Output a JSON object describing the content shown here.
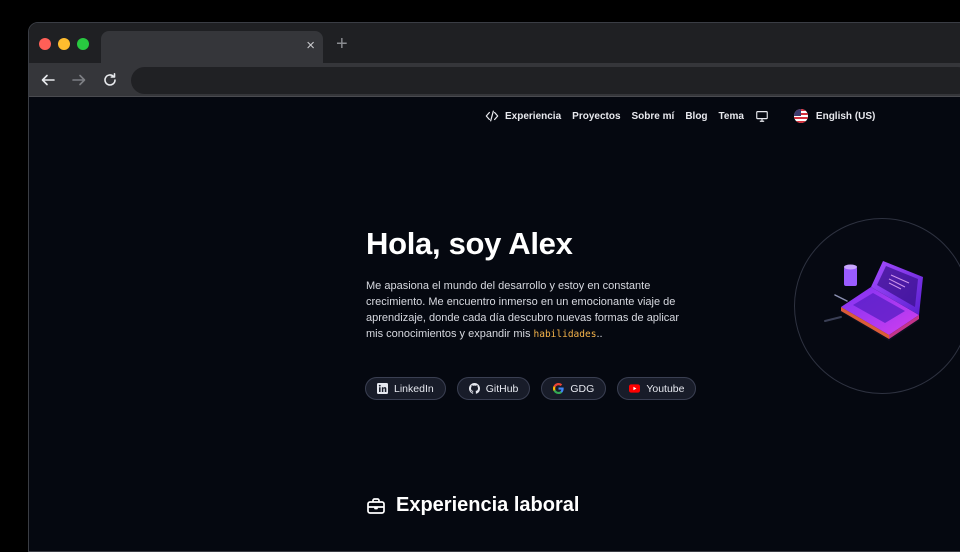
{
  "browser": {
    "tab_close": "×",
    "new_tab": "+"
  },
  "nav": {
    "experiencia": "Experiencia",
    "proyectos": "Proyectos",
    "sobre_mi": "Sobre mí",
    "blog": "Blog",
    "tema": "Tema",
    "language": "English (US)"
  },
  "hero": {
    "title": "Hola, soy Alex",
    "text": "Me apasiona el mundo del desarrollo y estoy en constante crecimiento. Me encuentro inmerso en un emocionante viaje de aprendizaje, donde cada día descubro nuevas formas de aplicar mis conocimientos y expandir mis ",
    "keyword": "habilidades",
    "ending": ".."
  },
  "socials": {
    "linkedin": "LinkedIn",
    "github": "GitHub",
    "gdg": "GDG",
    "youtube": "Youtube"
  },
  "section": {
    "title": "Experiencia laboral"
  },
  "colors": {
    "background": "#050810",
    "accent_keyword": "#f5b34a",
    "pill_bg": "#181c29",
    "illustration_purple": "#8b3dff"
  },
  "icons": [
    "code-icon",
    "monitor-icon",
    "us-flag-icon",
    "linkedin-icon",
    "github-icon",
    "google-icon",
    "youtube-icon",
    "briefcase-icon",
    "laptop-illustration"
  ]
}
